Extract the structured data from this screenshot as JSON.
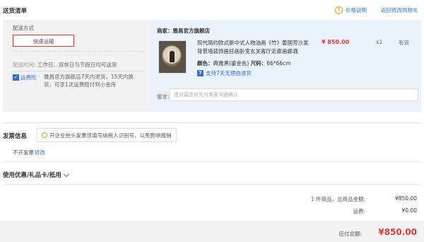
{
  "header": {
    "title": "送货清单",
    "help_icon": "info-icon",
    "help_label": "价格说明",
    "back_label": "返回修改购物车"
  },
  "shipping": {
    "label": "配送方式",
    "method": "快速运输",
    "time_key": "配送时间:",
    "time_value": "工作日、双休日与节假日均可送货",
    "yunfeixian_label": "运费险",
    "yunfeixian_desc": "雅昌官方旗舰店7天内退货，15天内换货，可享1次运费赔付到小金库"
  },
  "seller": {
    "label": "商家：雅昌官方旗舰店"
  },
  "product": {
    "name": "现代简约欧式新中式人物油画《竹》姜国芳沙发背景墙装饰画挂画卧室玄关客厅走廊画廊酒",
    "price": "¥ 850.00",
    "quantity": "x1",
    "stock": "有货",
    "spec_key_color": "颜色：",
    "spec_color": "典雅黑(鎏金色)",
    "spec_key_size": "尺码：",
    "spec_size": "66*66cm",
    "return_badge": "7",
    "return_label": "支持7天无理由退货"
  },
  "note": {
    "label": "留言:",
    "placeholder": "建议留言前先与商家沟通确认"
  },
  "invoice": {
    "title": "发票信息",
    "tip": "开企业抬头发票须填写纳税人识别号，以免影响报销",
    "value": "不开发票",
    "edit": "修改"
  },
  "coupon": {
    "title": "使用优惠/礼品卡/抵用"
  },
  "summary": {
    "item_count": "1",
    "item_suffix": "件商品，总商品金额:",
    "goods_total": "¥850.00",
    "shipping_label": "运费:",
    "shipping_value": "¥0.00",
    "payable_label": "应付总额:",
    "payable_value": "¥850.00"
  },
  "colors": {
    "accent_red": "#e4393c",
    "link_blue": "#3a6fc9",
    "panel_blue": "#eaf3fb"
  }
}
